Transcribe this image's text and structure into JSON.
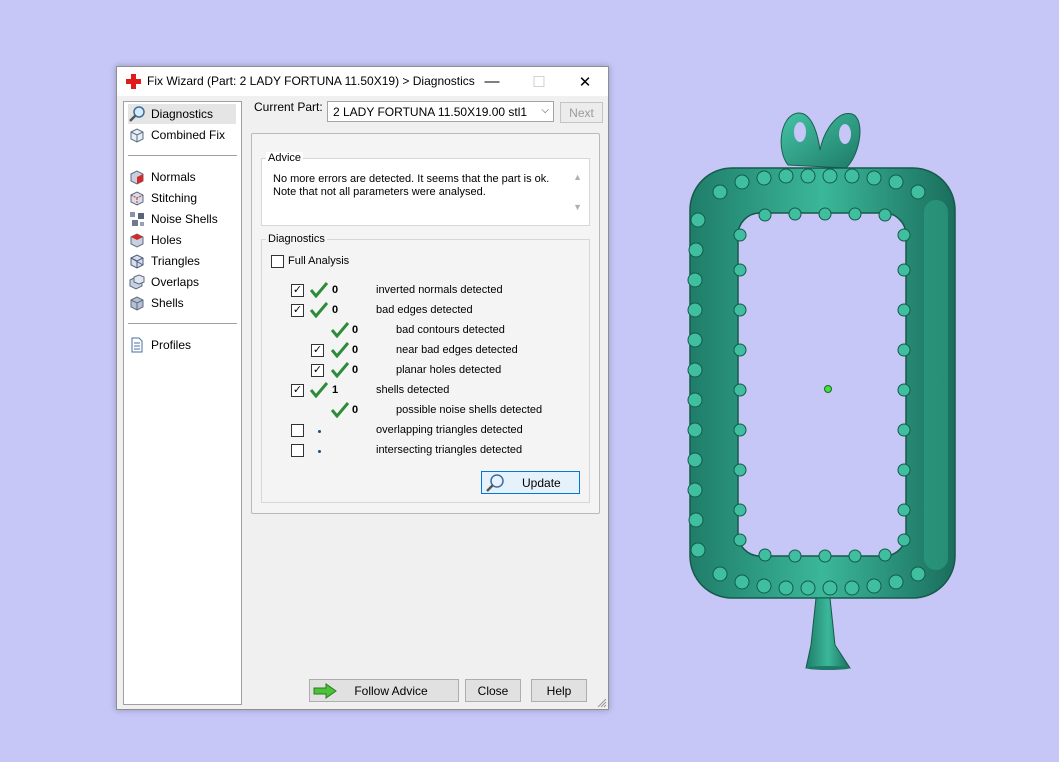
{
  "window": {
    "title": "Fix Wizard (Part: 2 LADY FORTUNA 11.50X19) > Diagnostics",
    "controls": {
      "minimize": "—",
      "maximize": "☐",
      "close": "✕"
    }
  },
  "sidebar": {
    "items": [
      {
        "label": "Diagnostics",
        "icon": "magnifier-icon"
      },
      {
        "label": "Combined Fix",
        "icon": "cube-wire-icon"
      },
      {
        "label": "Normals",
        "icon": "normals-icon"
      },
      {
        "label": "Stitching",
        "icon": "stitching-icon"
      },
      {
        "label": "Noise Shells",
        "icon": "noise-shells-icon"
      },
      {
        "label": "Holes",
        "icon": "holes-icon"
      },
      {
        "label": "Triangles",
        "icon": "triangles-icon"
      },
      {
        "label": "Overlaps",
        "icon": "overlaps-icon"
      },
      {
        "label": "Shells",
        "icon": "shells-icon"
      },
      {
        "label": "Profiles",
        "icon": "document-icon"
      }
    ]
  },
  "part": {
    "label": "Current Part:",
    "selected": "2 LADY FORTUNA 11.50X19.00 stl1",
    "next_label": "Next"
  },
  "advice": {
    "title": "Advice",
    "text": "No more errors are detected. It seems that the part is ok. Note that not all parameters were analysed."
  },
  "diagnostics": {
    "title": "Diagnostics",
    "full_analysis_label": "Full Analysis",
    "rows": [
      {
        "count": "0",
        "label": "inverted normals detected"
      },
      {
        "count": "0",
        "label": "bad edges detected"
      },
      {
        "count": "0",
        "label": "bad contours detected"
      },
      {
        "count": "0",
        "label": "near bad edges detected"
      },
      {
        "count": "0",
        "label": "planar holes detected"
      },
      {
        "count": "1",
        "label": "shells detected"
      },
      {
        "count": "0",
        "label": "possible noise shells detected"
      },
      {
        "count": "",
        "label": "overlapping triangles detected"
      },
      {
        "count": "",
        "label": "intersecting triangles detected"
      }
    ],
    "update_label": "Update"
  },
  "footer": {
    "follow_advice_label": "Follow Advice",
    "close_label": "Close",
    "help_label": "Help"
  },
  "colors": {
    "background": "#c6c6f7",
    "model": "#2f9f86",
    "check": "#2e8b3a",
    "accent": "#0078d7"
  }
}
